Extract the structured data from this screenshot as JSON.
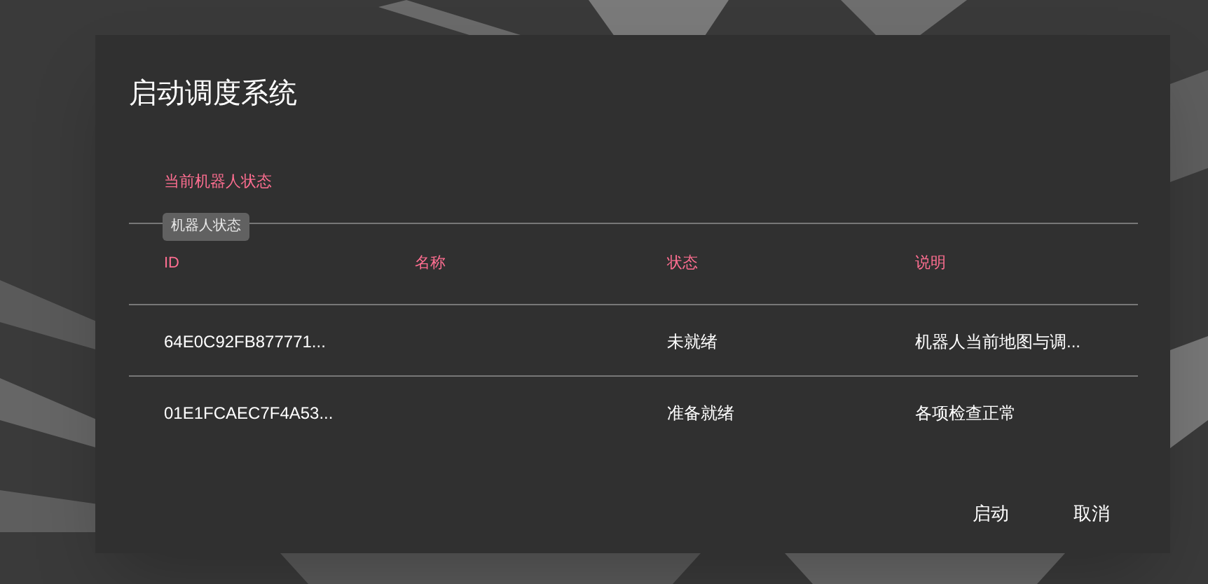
{
  "dialog": {
    "title": "启动调度系统",
    "section_label": "当前机器人状态",
    "tooltip": "机器人状态",
    "table": {
      "columns": [
        "ID",
        "名称",
        "状态",
        "说明"
      ],
      "rows": [
        {
          "cells": [
            "64E0C92FB877771...",
            "",
            "未就绪",
            "机器人当前地图与调..."
          ]
        },
        {
          "cells": [
            "01E1FCAEC7F4A53...",
            "",
            "准备就绪",
            "各项检查正常"
          ]
        }
      ]
    },
    "buttons": [
      "启动",
      "取消"
    ]
  }
}
